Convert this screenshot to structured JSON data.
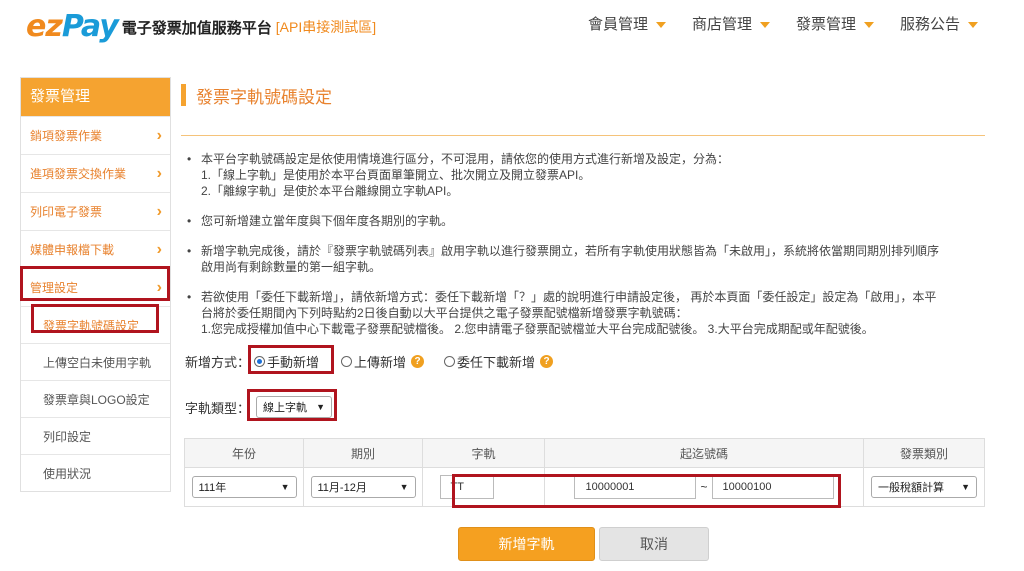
{
  "header": {
    "logo_ez": "ez",
    "logo_pay": "Pay",
    "logo_subtitle": "電子發票加值服務平台",
    "logo_tag": "[API串接測試區]",
    "nav": [
      "會員管理",
      "商店管理",
      "發票管理",
      "服務公告"
    ]
  },
  "sidebar": {
    "heading": "發票管理",
    "items": [
      {
        "label": "銷項發票作業"
      },
      {
        "label": "進項發票交換作業"
      },
      {
        "label": "列印電子發票"
      },
      {
        "label": "媒體申報檔下載"
      },
      {
        "label": "管理設定"
      }
    ],
    "subitems": [
      {
        "label": "發票字軌號碼設定"
      },
      {
        "label": "上傳空白未使用字軌"
      },
      {
        "label": "發票章與LOGO設定"
      },
      {
        "label": "列印設定"
      },
      {
        "label": "使用狀況"
      }
    ]
  },
  "main": {
    "title": "發票字軌號碼設定",
    "notes": [
      {
        "lines": [
          "本平台字軌號碼設定是依使用情境進行區分，不可混用，請依您的使用方式進行新增及設定，分為：",
          "1.「線上字軌」是使用於本平台頁面單筆開立、批次開立及開立發票API。",
          "2.「離線字軌」是使於本平台離線開立字軌API。"
        ]
      },
      {
        "lines": [
          "您可新增建立當年度與下個年度各期別的字軌。"
        ]
      },
      {
        "lines": [
          "新增字軌完成後，請於『發票字軌號碼列表』啟用字軌以進行發票開立，若所有字軌使用狀態皆為「未啟用」，系統將依當期同期別排列順序",
          "啟用尚有剩餘數量的第一組字軌。"
        ]
      },
      {
        "lines": [
          "若欲使用「委任下載新增」，請依新增方式：委任下載新增「？」處的說明進行申請設定後， 再於本頁面「委任設定」設定為「啟用」，本平",
          "台將於委任期間內下列時點約2日後自動以大平台提供之電子發票配號檔新增發票字軌號碼：",
          "1.您完成授權加值中心下載電子發票配號檔後。 2.您申請電子發票配號檔並大平台完成配號後。 3.大平台完成期配或年配號後。"
        ]
      }
    ],
    "mode_label": "新增方式：",
    "modes": [
      {
        "label": "手動新增",
        "checked": true
      },
      {
        "label": "上傳新增",
        "checked": false
      },
      {
        "label": "委任下載新增",
        "checked": false
      }
    ],
    "help_glyph": "?",
    "type_label": "字軌類型：",
    "type_value": "線上字軌",
    "table": {
      "headers": [
        "年份",
        "期別",
        "字軌",
        "起迄號碼",
        "發票類別"
      ],
      "year": "111年",
      "period": "11月-12月",
      "track": "TT",
      "start_no": "10000001",
      "range_sep": "~",
      "end_no": "10000100",
      "invoice_type": "一般稅額計算"
    },
    "add_button": "新增字軌",
    "cancel_button": "取消"
  },
  "colors": {
    "accent": "#f5a330",
    "highlight_border": "#b0141e",
    "link": "#e8822e"
  }
}
